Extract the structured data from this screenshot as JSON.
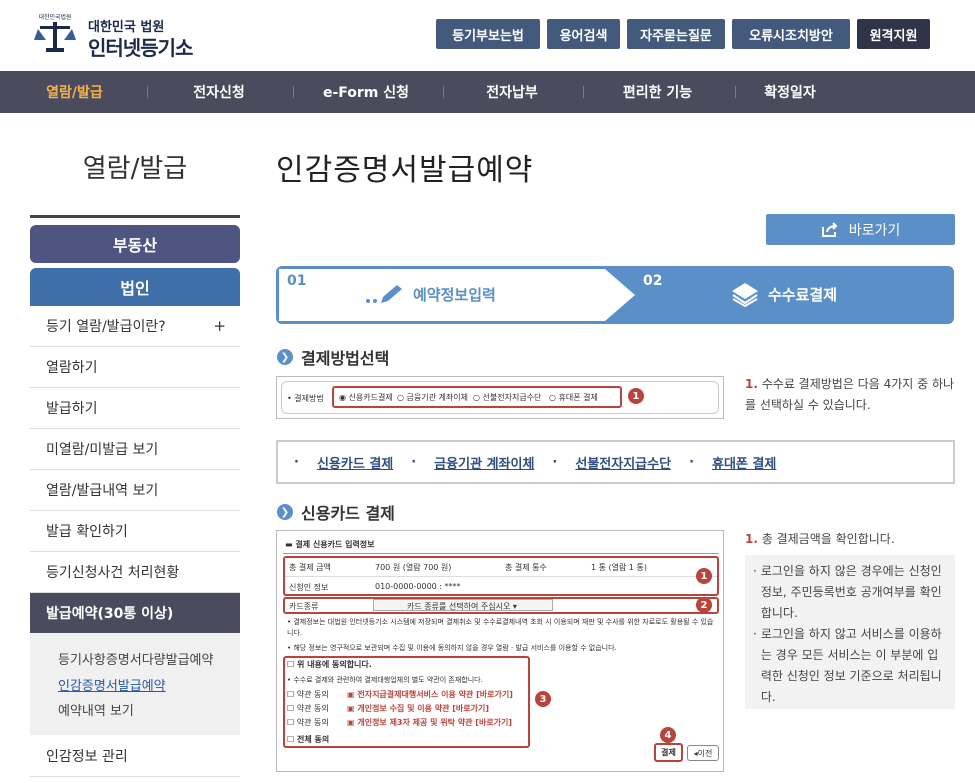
{
  "header": {
    "logo_small": "대한민국 법원",
    "logo_main": "인터넷등기소",
    "logo_arc": "대한민국법원",
    "top_buttons": [
      "등기부보는법",
      "용어검색",
      "자주묻는질문",
      "오류시조치방안",
      "원격지원"
    ]
  },
  "nav": {
    "items": [
      "열람/발급",
      "전자신청",
      "e-Form 신청",
      "전자납부",
      "편리한 기능",
      "확정일자"
    ]
  },
  "sidebar": {
    "title": "열람/발급",
    "btn_real_estate": "부동산",
    "btn_corp": "법인",
    "items": [
      "등기 열람/발급이란?",
      "열람하기",
      "발급하기",
      "미열람/미발급 보기",
      "열람/발급내역 보기",
      "발급 확인하기",
      "등기신청사건 처리현황",
      "발급예약(30통 이상)"
    ],
    "plus": "+",
    "sub_items": [
      "등기사항증명서다량발급예약",
      "인감증명서발급예약",
      "예약내역 보기"
    ],
    "last_item": "인감정보 관리"
  },
  "main": {
    "title": "인감증명서발급예약",
    "shortcut": "바로가기",
    "steps": [
      {
        "num": "01",
        "label": "예약정보입력"
      },
      {
        "num": "02",
        "label": "수수료결제"
      }
    ],
    "section1": "결제방법선택",
    "pay_label": "결제방법",
    "pay_options": [
      "신용카드결제",
      "금융기관 계좌이체",
      "선불전자지급수단",
      "휴대폰 결제"
    ],
    "desc1_num": "1.",
    "desc1": "수수료 결제방법은 다음 4가지 중 하나를 선택하실 수 있습니다.",
    "links": [
      "신용카드 결제",
      "금융기관 계좌이체",
      "선불전자지급수단",
      "휴대폰 결제"
    ],
    "section2": "신용카드 결제",
    "form_title": "결제 신용카드 입력정보",
    "row1": [
      "총 결제 금액",
      "700 원 (열람 700 원)",
      "총 결제 통수",
      "1 통 (열람 1 통)"
    ],
    "row2": [
      "신청인 정보",
      "010-0000-0000 : ****"
    ],
    "card_label": "카드종류",
    "card_select": "카드 종류를 선택하여 주십시오",
    "notice1": "결제정보는 대법원 인터넷등기소 시스템에 저장되며 결제취소 및 수수료결제내역 조회 시 이용되며 재판 및 수사를 위한 자료로도 활용될 수 있습니다.",
    "notice2": "해당 정보는 영구적으로 보관되며 수집 및 이용에 동의하지 않을 경우 열람 · 발급 서비스를 이용할 수 없습니다.",
    "agree_all_top": "위 내용에 동의합니다.",
    "agree_notice": "수수료 결제와 관련하여 결제대행업체의 별도 약관이 존재합니다.",
    "agree_rows": [
      {
        "label": "약관 동의",
        "link": "전자지급결제대행서비스 이용 약관 [바로가기]"
      },
      {
        "label": "약관 동의",
        "link": "개인정보 수집 및 이용 약관 [바로가기]"
      },
      {
        "label": "약관 동의",
        "link": "개인정보 제3자 제공 및 위탁 약관 [바로가기]"
      }
    ],
    "agree_all": "전체 동의",
    "btn_pay": "결제",
    "btn_prev": "이전",
    "markers": [
      "1",
      "2",
      "3",
      "4"
    ],
    "desc2_num": "1.",
    "desc2": "총 결제금액을 확인합니다.",
    "notes": [
      "로그인을 하지 않은 경우에는 신청인 정보, 주민등록번호 공개여부를 확인합니다.",
      "로그인을 하지 않고 서비스를 이용하는 경우 모든 서비스는 이 부분에 입력한 신청인 정보 기준으로 처리됩니다."
    ]
  },
  "colors": {
    "nav_bg": "#4a4c5e",
    "accent": "#5a8fc8",
    "active_nav": "#f5b24a",
    "marker": "#b8443b"
  }
}
